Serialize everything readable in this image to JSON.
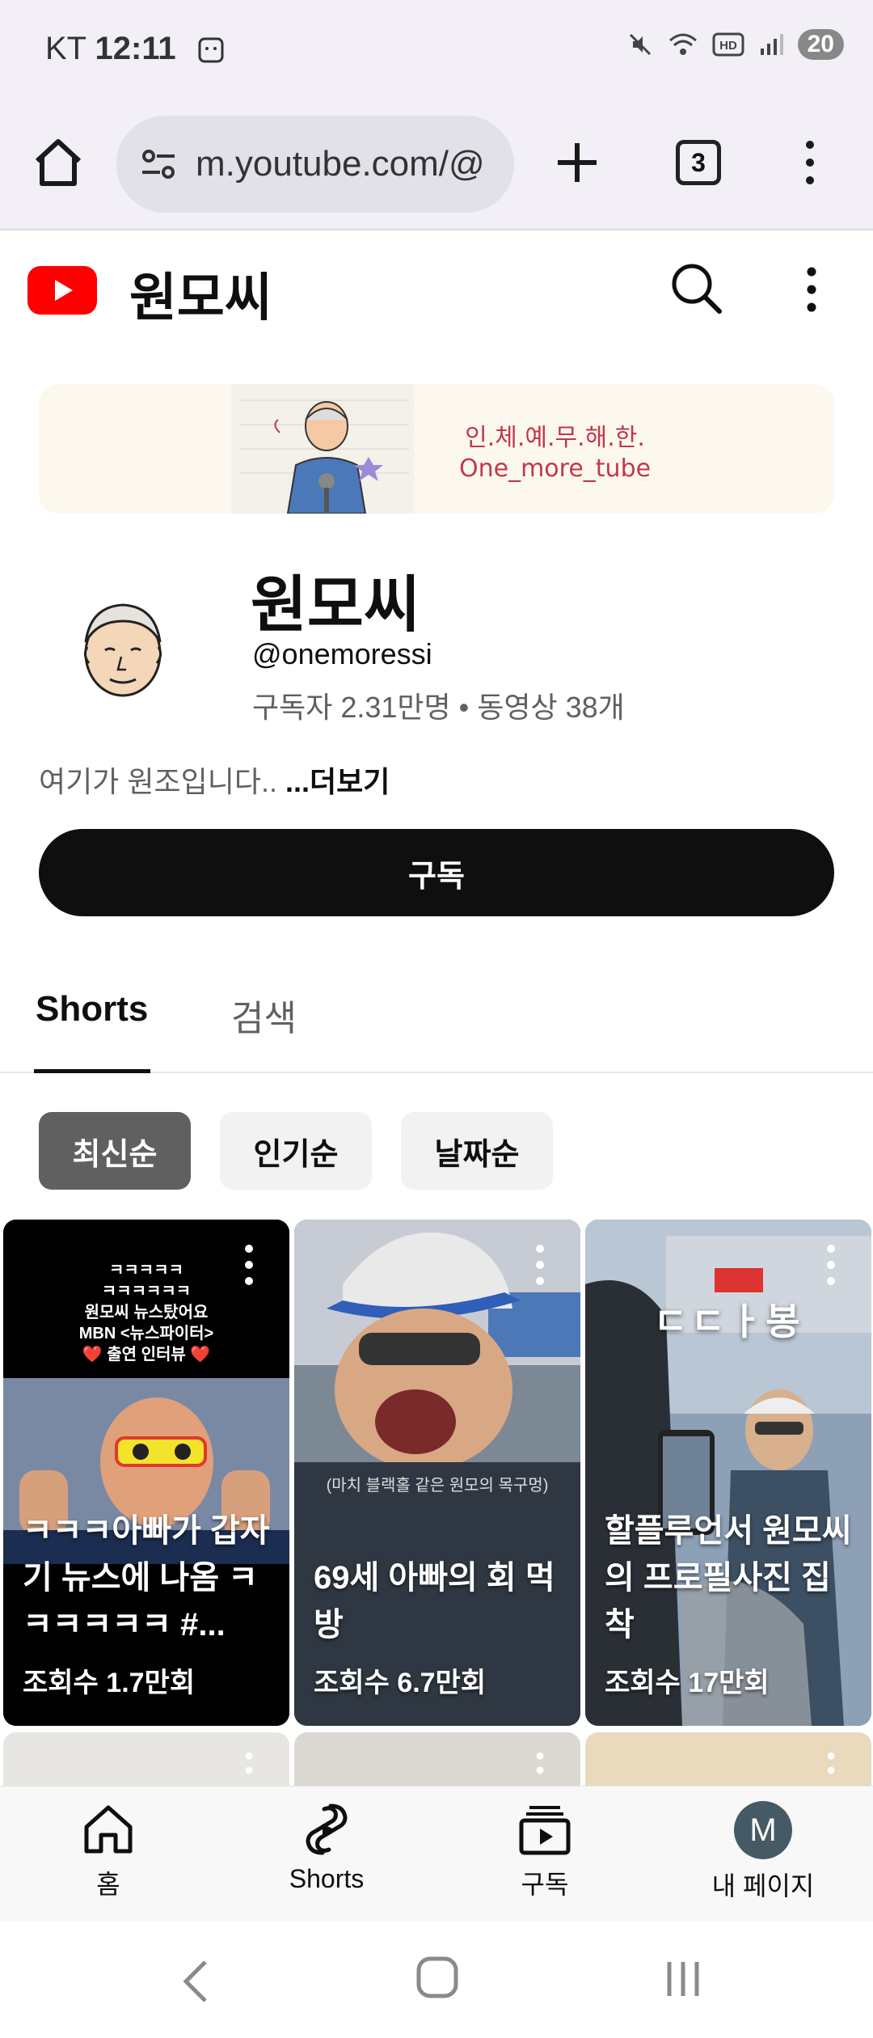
{
  "status_bar": {
    "carrier": "KT",
    "time": "12:11",
    "battery": "20"
  },
  "browser": {
    "url": "m.youtube.com/@",
    "tab_count": "3"
  },
  "header": {
    "title": "원모씨"
  },
  "banner": {
    "line1": "인.체.예.무.해.한.",
    "line2": "One_more_tube"
  },
  "channel": {
    "name": "원모씨",
    "handle": "@onemoressi",
    "meta": "구독자 2.31만명 • 동영상 38개",
    "description": "여기가 원조입니다.. ",
    "more_label": "...더보기",
    "subscribe_label": "구독"
  },
  "tabs": [
    {
      "label": "Shorts"
    },
    {
      "label": "검색"
    }
  ],
  "chips": [
    {
      "label": "최신순"
    },
    {
      "label": "인기순"
    },
    {
      "label": "날짜순"
    }
  ],
  "shorts": [
    {
      "title": "ㅋㅋㅋ아빠가 갑자기 뉴스에 나옴 ㅋㅋㅋㅋㅋㅋ #...",
      "views": "조회수 1.7만회",
      "overlay_lines": [
        "ㅋㅋㅋㅋㅋ",
        "ㅋㅋㅋㅋㅋㅋ",
        "원모씨 뉴스탔어요",
        "MBN <뉴스파이터>",
        "❤️ 출연 인터뷰 ❤️"
      ]
    },
    {
      "title": "69세 아빠의 회 먹방",
      "views": "조회수 6.7만회",
      "overlay_lines": [
        "(마치 블랙홀 같은 원모의 목구멍)"
      ]
    },
    {
      "title": "할플루언서 원모씨의 프로필사진 집착",
      "views": "조회수 17만회",
      "overlay_lines": [
        "ㄷㄷㅏ봉"
      ]
    }
  ],
  "bottom_nav": [
    {
      "label": "홈",
      "icon": "home-icon"
    },
    {
      "label": "Shorts",
      "icon": "shorts-icon"
    },
    {
      "label": "구독",
      "icon": "subscriptions-icon"
    },
    {
      "label": "내 페이지",
      "avatar_letter": "M"
    }
  ]
}
